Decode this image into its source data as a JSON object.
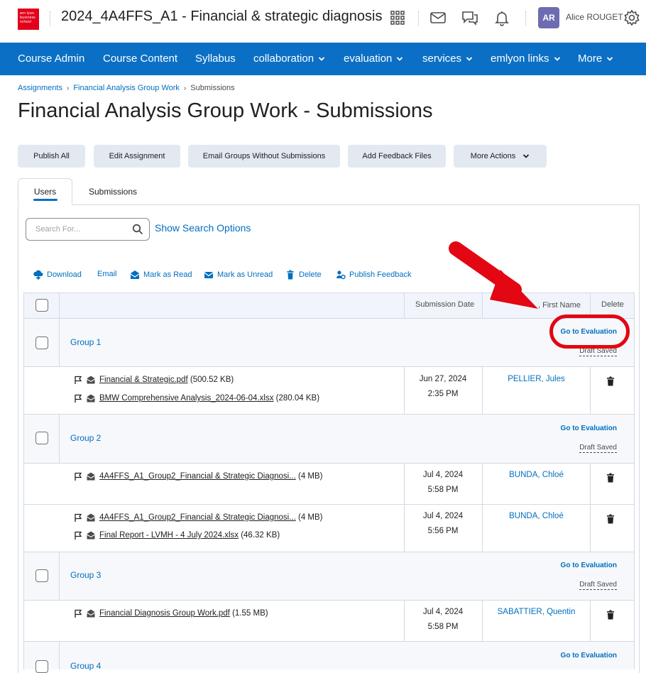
{
  "header": {
    "logo_text": "em lyon business school",
    "course_title": "2024_4A4FFS_A1 - Financial & strategic diagnosis",
    "user_initials": "AR",
    "user_name": "Alice ROUGET"
  },
  "nav": {
    "items": [
      {
        "label": "Course Admin",
        "dropdown": false
      },
      {
        "label": "Course Content",
        "dropdown": false
      },
      {
        "label": "Syllabus",
        "dropdown": false
      },
      {
        "label": "collaboration",
        "dropdown": true
      },
      {
        "label": "evaluation",
        "dropdown": true
      },
      {
        "label": "services",
        "dropdown": true
      },
      {
        "label": "emlyon links",
        "dropdown": true
      },
      {
        "label": "More",
        "dropdown": true
      }
    ]
  },
  "breadcrumb": {
    "items": [
      "Assignments",
      "Financial Analysis Group Work"
    ],
    "current": "Submissions"
  },
  "page": {
    "title": "Financial Analysis Group Work - Submissions"
  },
  "actions": {
    "buttons": [
      "Publish All",
      "Edit Assignment",
      "Email Groups Without Submissions",
      "Add Feedback Files",
      "More Actions"
    ]
  },
  "tabs": {
    "users": "Users",
    "submissions": "Submissions"
  },
  "search": {
    "placeholder": "Search For...",
    "options_link": "Show Search Options"
  },
  "bulk_actions": [
    "Download",
    "Email",
    "Mark as Read",
    "Mark as Unread",
    "Delete",
    "Publish Feedback"
  ],
  "table": {
    "headers": {
      "submission_date": "Submission Date",
      "first_name": ", First Name",
      "delete": "Delete"
    },
    "go_to_evaluation": "Go to Evaluation",
    "draft_saved": "Draft Saved",
    "groups": [
      {
        "name": "Group 1",
        "submissions": [
          {
            "files": [
              {
                "name": "Financial & Strategic.pdf",
                "size": "(500.52 KB)"
              },
              {
                "name": "BMW Comprehensive Analysis_2024-06-04.xlsx",
                "size": "(280.04 KB)"
              }
            ],
            "date": "Jun 27, 2024",
            "time": "2:35 PM",
            "person": "PELLIER, Jules"
          }
        ]
      },
      {
        "name": "Group 2",
        "submissions": [
          {
            "files": [
              {
                "name": "4A4FFS_A1_Group2_Financial & Strategic Diagnosi...",
                "size": "(4 MB)"
              }
            ],
            "date": "Jul 4, 2024",
            "time": "5:58 PM",
            "person": "BUNDA, Chloé"
          },
          {
            "files": [
              {
                "name": "4A4FFS_A1_Group2_Financial & Strategic Diagnosi...",
                "size": "(4 MB)"
              },
              {
                "name": "Final Report - LVMH - 4 July 2024.xlsx",
                "size": "(46.32 KB)"
              }
            ],
            "date": "Jul 4, 2024",
            "time": "5:56 PM",
            "person": "BUNDA, Chloé"
          }
        ]
      },
      {
        "name": "Group 3",
        "submissions": [
          {
            "files": [
              {
                "name": "Financial Diagnosis Group Work.pdf",
                "size": "(1.55 MB)"
              }
            ],
            "date": "Jul 4, 2024",
            "time": "5:58 PM",
            "person": "SABATTIER, Quentin"
          }
        ]
      },
      {
        "name": "Group 4",
        "submissions": []
      }
    ]
  },
  "colors": {
    "nav_bg": "#0b70c5",
    "link": "#006fbf",
    "button_bg": "#e3e9f1",
    "annotation_red": "#e30613",
    "avatar_bg": "#6d6bb1"
  }
}
